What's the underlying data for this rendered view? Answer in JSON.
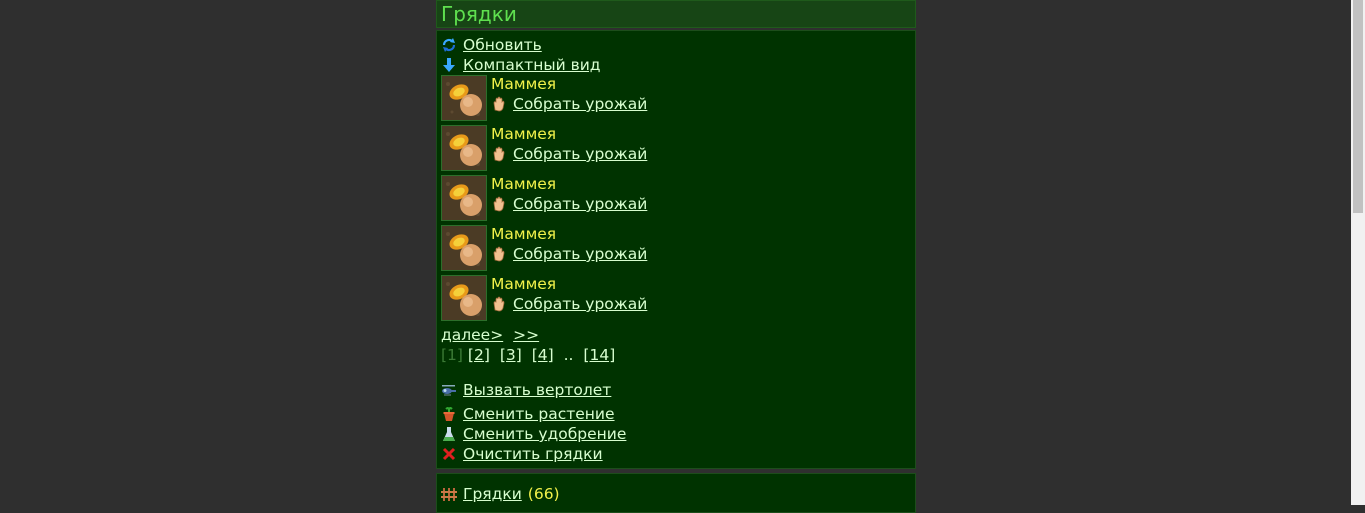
{
  "header": {
    "title": "Грядки"
  },
  "actions_top": {
    "refresh": "Обновить",
    "compact": "Компактный вид"
  },
  "plots": [
    {
      "name": "Маммея",
      "action": "Собрать урожай"
    },
    {
      "name": "Маммея",
      "action": "Собрать урожай"
    },
    {
      "name": "Маммея",
      "action": "Собрать урожай"
    },
    {
      "name": "Маммея",
      "action": "Собрать урожай"
    },
    {
      "name": "Маммея",
      "action": "Собрать урожай"
    }
  ],
  "pager": {
    "next": "далее>",
    "last": ">>",
    "current": "[1]",
    "pages": [
      "[2]",
      "[3]",
      "[4]"
    ],
    "ellipsis": "..",
    "final": "[14]"
  },
  "actions_bottom": {
    "helicopter": "Вызвать вертолет",
    "change_plant": "Сменить растение",
    "change_fertilizer": "Сменить удобрение",
    "clear_beds": "Очистить грядки"
  },
  "footer": {
    "beds_label": "Грядки",
    "beds_count": "(66)"
  },
  "icons": {
    "refresh": "refresh-icon",
    "compact": "arrow-down-icon",
    "harvest": "hand-icon",
    "helicopter": "helicopter-icon",
    "plant": "flowerpot-icon",
    "fertilizer": "flask-icon",
    "clear": "cross-icon",
    "beds": "fence-icon"
  },
  "colors": {
    "background": "#2f2f2f",
    "panel": "#003300",
    "header": "#174515",
    "title": "#5fe04f",
    "link": "#d8ffd0",
    "plant_name": "#f2f24a"
  }
}
